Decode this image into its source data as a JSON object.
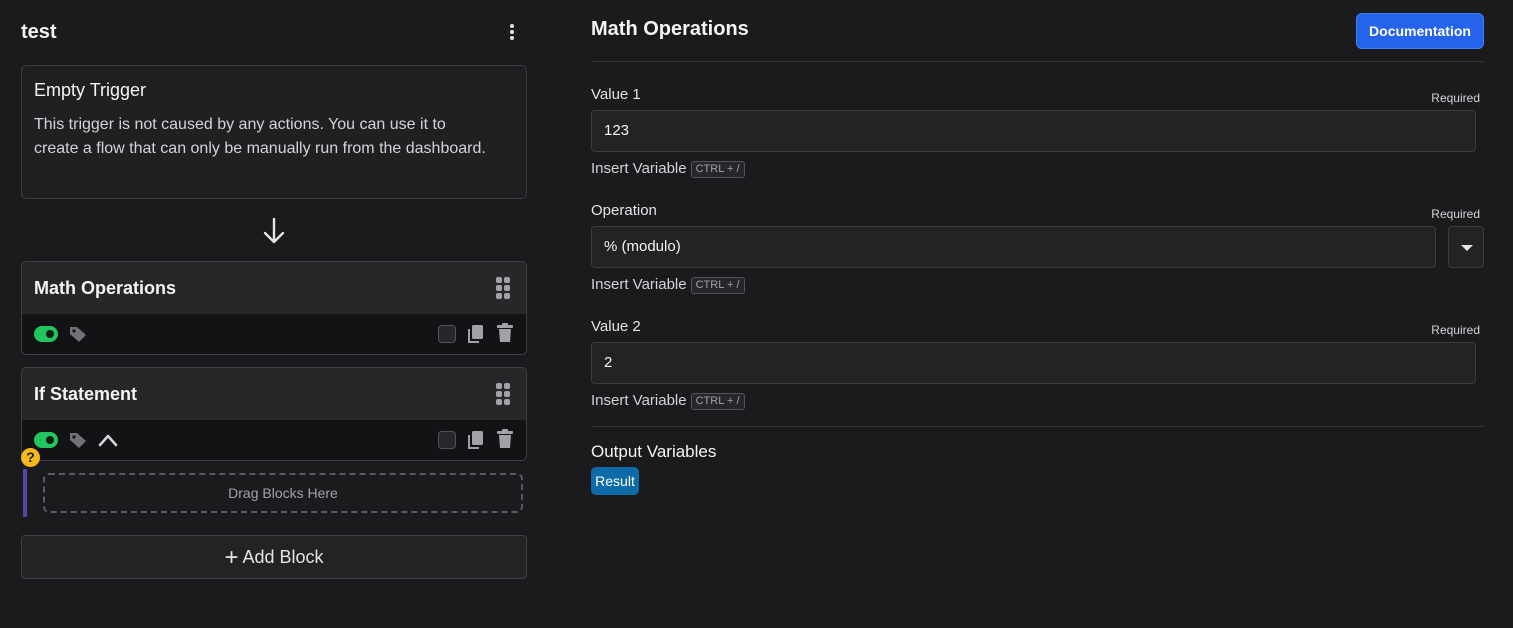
{
  "flow": {
    "title": "test"
  },
  "trigger": {
    "title": "Empty Trigger",
    "description": "This trigger is not caused by any actions. You can use it to create a flow that can only be manually run from the dashboard."
  },
  "blocks": [
    {
      "name": "Math Operations",
      "enabled": true
    },
    {
      "name": "If Statement",
      "enabled": true
    }
  ],
  "branch": {
    "help_icon": "?",
    "drop_zone_label": "Drag Blocks Here"
  },
  "add_block": {
    "label": "Add Block"
  },
  "panel": {
    "title": "Math Operations",
    "documentation_label": "Documentation",
    "required_label": "Required",
    "insert_variable_label": "Insert Variable",
    "shortcut": "CTRL + /",
    "fields": {
      "value1": {
        "label": "Value 1",
        "value": "123"
      },
      "operation": {
        "label": "Operation",
        "value": "% (modulo)"
      },
      "value2": {
        "label": "Value 2",
        "value": "2"
      }
    },
    "output": {
      "title": "Output Variables",
      "variables": [
        "Result"
      ]
    }
  },
  "colors": {
    "background": "#1b1b1e",
    "toggle_on": "#22c55e",
    "primary_button": "#2563eb",
    "output_chip": "#0e6ba8",
    "help_badge": "#f5b821",
    "branch_line": "#4f46a5"
  },
  "icons": [
    "kebab-menu-icon",
    "arrow-down-icon",
    "drag-grip-icon",
    "tag-icon",
    "chevron-up-icon",
    "copy-icon",
    "trash-icon",
    "help-icon",
    "plus-icon",
    "dropdown-caret-icon"
  ]
}
